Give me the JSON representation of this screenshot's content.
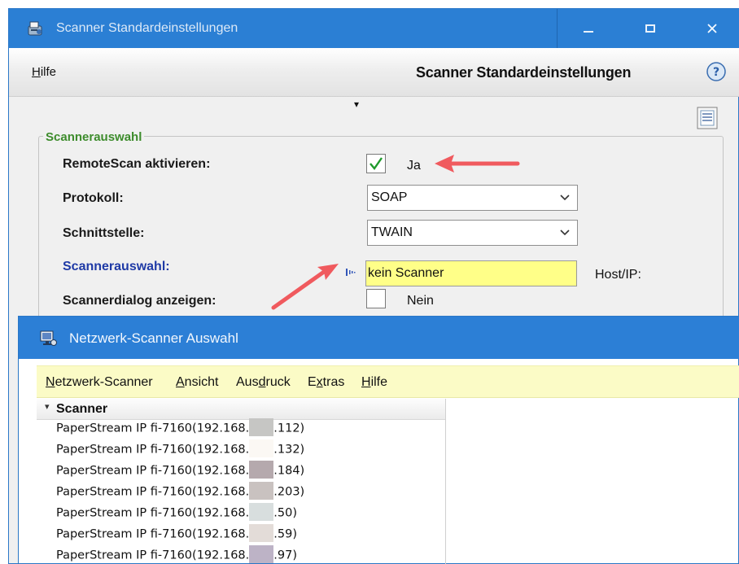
{
  "main_window": {
    "title": "Scanner Standardeinstellungen",
    "menu_hilfe_accel": "H",
    "menu_hilfe_rest": "ilfe",
    "heading": "Scanner Standardeinstellungen",
    "caret": "▾"
  },
  "scanner_group": {
    "title": "Scannerauswahl",
    "remote_label": "RemoteScan aktivieren:",
    "remote_value": "Ja",
    "protokoll_label": "Protokoll:",
    "protokoll_value": "SOAP",
    "schnittstelle_label": "Schnittstelle:",
    "schnittstelle_value": "TWAIN",
    "scanner_label": "Scannerauswahl:",
    "scanner_value": "kein Scanner",
    "hostip_label": "Host/IP:",
    "dialog_label": "Scannerdialog anzeigen:",
    "dialog_value": "Nein"
  },
  "network_window": {
    "title": "Netzwerk-Scanner Auswahl",
    "menu": [
      {
        "accel": "N",
        "rest": "etzwerk-Scanner"
      },
      {
        "accel": "A",
        "rest": "nsicht"
      },
      {
        "pre": "Aus",
        "accel": "d",
        "rest": "ruck"
      },
      {
        "pre": "E",
        "accel": "x",
        "rest": "tras"
      },
      {
        "accel": "H",
        "rest": "ilfe"
      }
    ],
    "tree_header": "Scanner",
    "rows": [
      {
        "prefix": "PaperStream IP fi-7160(192.168.",
        "suffix": ".112)",
        "mask": "#c6c6c4"
      },
      {
        "prefix": "PaperStream IP fi-7160(192.168.",
        "suffix": ".132)",
        "mask": "#fbf8f4"
      },
      {
        "prefix": "PaperStream IP fi-7160(192.168.",
        "suffix": ".184)",
        "mask": "#b5a9ad"
      },
      {
        "prefix": "PaperStream IP fi-7160(192.168.",
        "suffix": ".203)",
        "mask": "#c9c2c0"
      },
      {
        "prefix": "PaperStream IP fi-7160(192.168.",
        "suffix": ".50)",
        "mask": "#d8dede"
      },
      {
        "prefix": "PaperStream IP fi-7160(192.168.",
        "suffix": ".59)",
        "mask": "#e3dcd8"
      },
      {
        "prefix": "PaperStream IP fi-7160(192.168.",
        "suffix": ".97)",
        "mask": "#bdb3c6"
      }
    ]
  },
  "colors": {
    "titlebar": "#2b7fd4",
    "group_title": "#3d8c2c",
    "link_label": "#1f3aa6",
    "highlight_input": "#ffff88",
    "annotation_arrow": "#f05a5e"
  }
}
